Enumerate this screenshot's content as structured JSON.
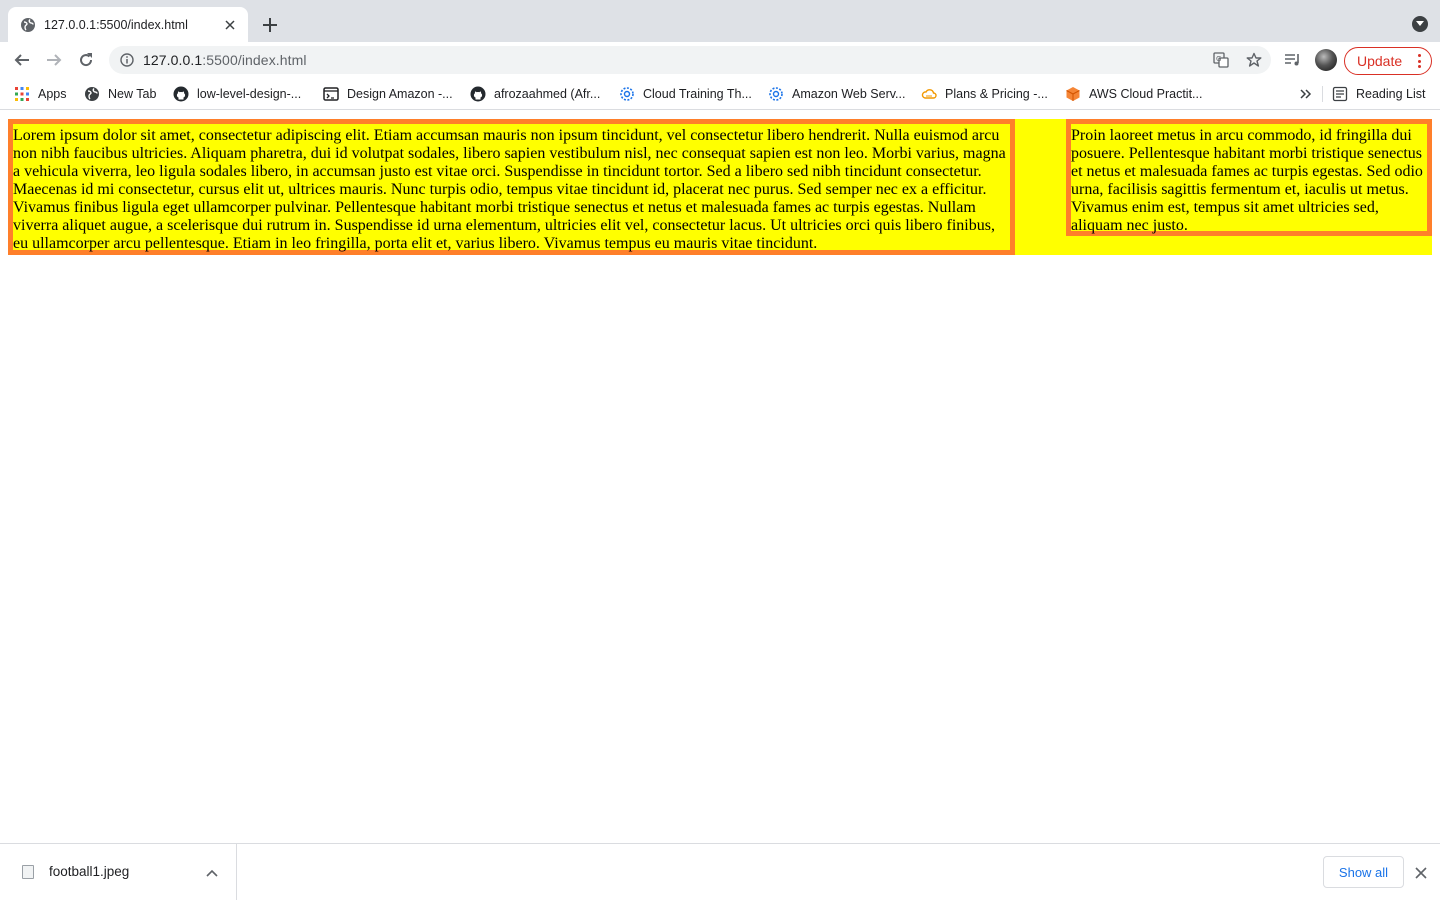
{
  "tab": {
    "title": "127.0.0.1:5500/index.html",
    "favicon": "globe-icon"
  },
  "address_bar": {
    "host": "127.0.0.1",
    "path": ":5500/index.html"
  },
  "toolbar": {
    "update_label": "Update",
    "accent": "#d93025"
  },
  "bookmarks": [
    {
      "label": "Apps",
      "icon": "apps-grid-icon"
    },
    {
      "label": "New Tab",
      "icon": "globe-icon"
    },
    {
      "label": "low-level-design-...",
      "icon": "github-icon"
    },
    {
      "label": "Design Amazon -...",
      "icon": "terminal-icon"
    },
    {
      "label": "afrozaahmed (Afr...",
      "icon": "github-icon"
    },
    {
      "label": "Cloud Training Th...",
      "icon": "gear-flower-icon"
    },
    {
      "label": "Amazon Web Serv...",
      "icon": "gear-flower-icon"
    },
    {
      "label": "Plans & Pricing -...",
      "icon": "cloud-icon"
    },
    {
      "label": "AWS Cloud Practit...",
      "icon": "aws-cube-icon"
    }
  ],
  "reading_list": "Reading List",
  "page": {
    "background": "#ffff00",
    "border_color": "#ff7f2a",
    "left_text": "Lorem ipsum dolor sit amet, consectetur adipiscing elit. Etiam accumsan mauris non ipsum tincidunt, vel consectetur libero hendrerit. Nulla euismod arcu non nibh faucibus ultricies. Aliquam pharetra, dui id volutpat sodales, libero sapien vestibulum nisl, nec consequat sapien est non leo. Morbi varius, magna a vehicula viverra, leo ligula sodales libero, in accumsan justo est vitae orci. Suspendisse in tincidunt tortor. Sed a libero sed nibh tincidunt consectetur. Maecenas id mi consectetur, cursus elit ut, ultrices mauris. Nunc turpis odio, tempus vitae tincidunt id, placerat nec purus. Sed semper nec ex a efficitur. Vivamus finibus ligula eget ullamcorper pulvinar. Pellentesque habitant morbi tristique senectus et netus et malesuada fames ac turpis egestas. Nullam viverra aliquet augue, a scelerisque dui rutrum in. Suspendisse id urna elementum, ultricies elit vel, consectetur lacus. Ut ultricies orci quis libero finibus, eu ullamcorper arcu pellentesque. Etiam in leo fringilla, porta elit et, varius libero. Vivamus tempus eu mauris vitae tincidunt.",
    "right_text": "Proin laoreet metus in arcu commodo, id fringilla dui posuere. Pellentesque habitant morbi tristique senectus et netus et malesuada fames ac turpis egestas. Sed odio urna, facilisis sagittis fermentum et, iaculis ut metus. Vivamus enim est, tempus sit amet ultricies sed, aliquam nec justo."
  },
  "download_bar": {
    "file_name": "football1.jpeg",
    "show_all": "Show all"
  }
}
